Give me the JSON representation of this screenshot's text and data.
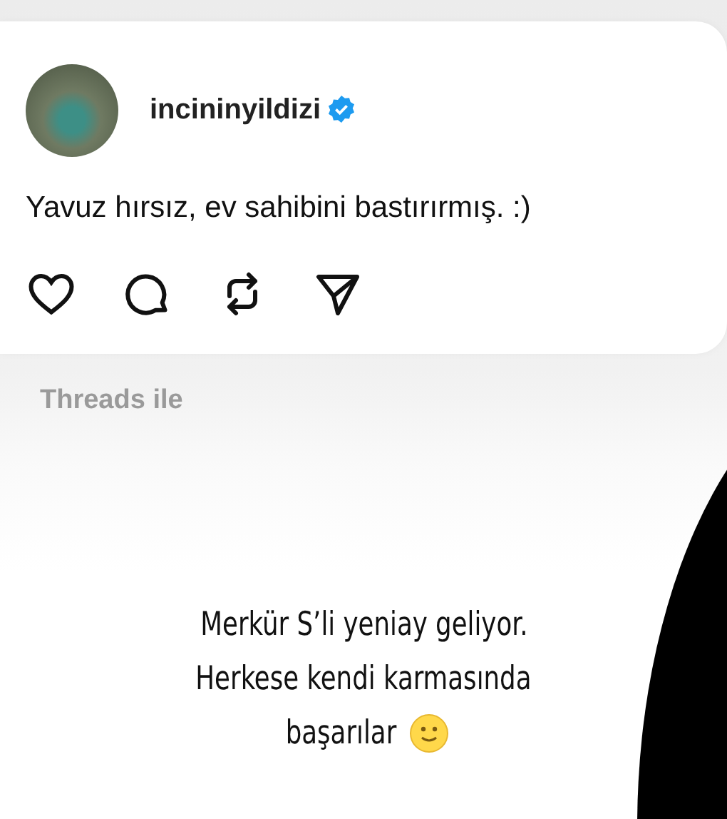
{
  "post": {
    "username": "incininyildizi",
    "verified": true,
    "text": "Yavuz hırsız, ev sahibini bastırırmış. :)"
  },
  "attribution": "Threads ile",
  "caption": [
    "Merkür S’li yeniay geliyor.",
    "Herkese kendi karmasında",
    "başarılar"
  ]
}
